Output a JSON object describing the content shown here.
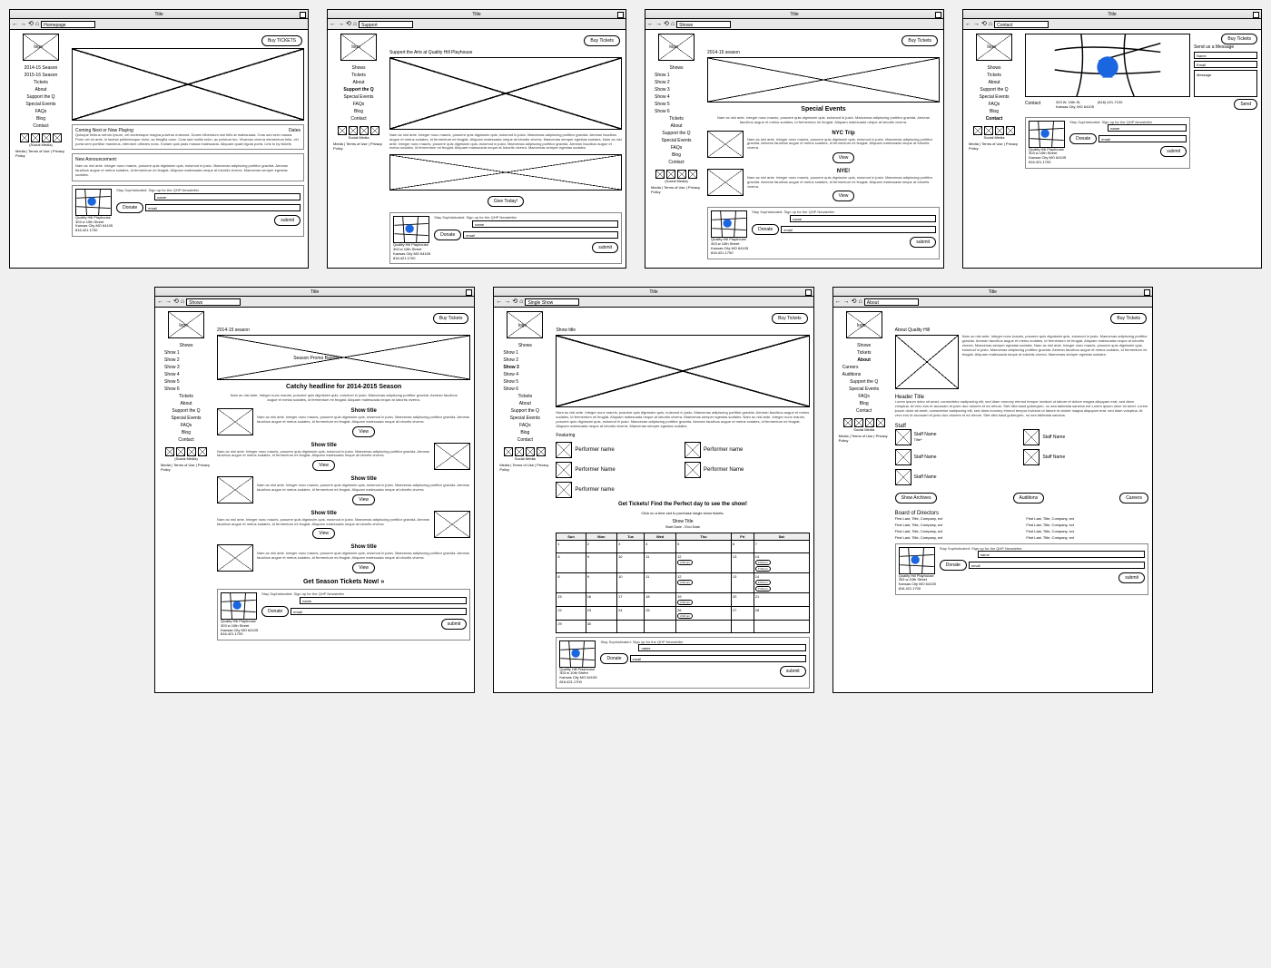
{
  "common": {
    "window_title": "Title",
    "buy_tickets": "Buy Tickets",
    "buy_tickets_caps": "Buy TICKETS",
    "logo": "logo",
    "social_label": "(Social Media)",
    "social_label2": "Social Media",
    "footer_links": "Media | Terms of Use | Privacy Policy",
    "signup_tag": "Stay Sophisticated: Sign up for the QHP Newsletter",
    "donate": "Donate",
    "name_ph": "name",
    "email_ph": "email",
    "submit": "submit",
    "send": "Send",
    "view": "View",
    "address": {
      "name": "Quality Hill Playhouse",
      "street": "303 w 10th Street",
      "city": "Kansas City MO 64105",
      "phone": "816.421.1700"
    },
    "lorem_short": "Nam ac nisl ante. Integer nunc mauris, posuere quis dignissim quis, euismod in justo. Maecenas adipiscing porttitor gravida. Aenean faucibus augue et metus sodales, id fermentum mi feugiat. Aliquam malesuada neque at lobortis viverra.",
    "lorem_med": "Nam ac nisl ante. Integer nunc mauris, posuere quis dignissim quis, euismod in justo. Maecenas adipiscing porttitor gravida. Aenean faucibus augue et metus sodales, id fermentum mi feugiat. Aliquam malesuada neque at lobortis viverra. Maecenas semper egestas sodales. Nam ac nisl ante. Integer nunc mauris, posuere quis dignissim quis, euismod in justo. Maecenas adipiscing porttitor gravida. Aenean faucibus augue et metus sodales, id fermentum mi feugiat. Aliquam malesuada neque at lobortis viverra. Maecenas semper egestas sodales."
  },
  "home": {
    "url": "Homepage",
    "nav": [
      "2014-15 Season",
      "2015-16 Season",
      "Tickets",
      "About",
      "Support the Q",
      "Special Events",
      "FAQs",
      "Blog",
      "Contact"
    ],
    "coming_label": "Coming Next or Now Playing",
    "dates_label": "Dates",
    "promo_text": "Quisque finibus rutrum ipsum, vel scelerisque magna pulvinar euismod. Donec bibendum nisl felis at malesuada. Cras sed sem massa. Proin vel mi ante, in lacinia pellentesque dolor, ac fringilla nunc. Cras sed mollis enim, ac pulvinar leo. Vivamus viverra elementum felis, vel porta sem porttitor maximus, interdum ultricies nunc. Kullam quis justo massa malesuada. Aliquam quam ligula porta. Link to by tickets",
    "new_ann": "New Announcement:",
    "ann_text": "Nam ac nisl ante. Integer nunc mauris, posuere quis dignissim quis, euismod in justo. Maecenas adipiscing porttitor gravida. Aenean faucibus augue et metus sodales, id fermentum mi feugiat. Aliquam malesuada neque at lobortis viverra. Maecenas semper egestas sodales."
  },
  "support": {
    "url": "Support",
    "nav": [
      "Shows",
      "Tickets",
      "About",
      "Support the Q",
      "Special Events",
      "FAQs",
      "Blog",
      "Contact"
    ],
    "headline": "Support the Arts at Quality Hill Playhouse",
    "cta": "Give Today!"
  },
  "shows_events": {
    "url": "Shows",
    "season": "2014-15 season",
    "nav": [
      "Shows",
      "Show 1",
      "Show 2",
      "Show 3",
      "Show 4",
      "Show 5",
      "Show 6",
      "Tickets",
      "About",
      "Support the Q",
      "Special Events",
      "FAQs",
      "Blog",
      "Contact"
    ],
    "special_events": "Special Events",
    "trip": "NYC Trip",
    "nye": "NYE!"
  },
  "contact": {
    "url": "Contact",
    "nav": [
      "Shows",
      "Tickets",
      "About",
      "Support the Q",
      "Special Events",
      "FAQs",
      "Blog",
      "Contact"
    ],
    "send_msg": "Send us a Message",
    "name": "Name",
    "email": "Email",
    "message": "Message",
    "contact_label": "Contact",
    "addr_street": "303 W. 10th St.",
    "addr_city": "Kansas City, MO 64105",
    "phone_fmt": "(816) 421-7100"
  },
  "shows_list": {
    "url": "Shows",
    "season": "2014-15 season",
    "nav": [
      "Shows",
      "Show 1",
      "Show 2",
      "Show 3",
      "Show 4",
      "Show 5",
      "Show 6",
      "Tickets",
      "About",
      "Support the Q",
      "Special Events",
      "FAQs",
      "Blog",
      "Contact"
    ],
    "banner": "Season Promo Banner",
    "headline": "Catchy headline for 2014-2015 Season",
    "show_title": "Show title",
    "cta": "Get Season Tickets Now! »"
  },
  "single_show": {
    "url": "Single Show",
    "nav": [
      "Shows",
      "Show 1",
      "Show 2",
      "Show 3",
      "Show 4",
      "Show 5",
      "Show 6",
      "Tickets",
      "About",
      "Support the Q",
      "Special Events",
      "FAQs",
      "Blog",
      "Contact"
    ],
    "show_title": "Show title",
    "featuring": "Featuring",
    "performer": "Performer Name",
    "performer_lc": "Performer name",
    "tix_head": "Get Tickets! Find the Perfect day to see the show!",
    "tix_sub": "Click on a time slot to purchase single show tickets.",
    "cal_title": "Show Title",
    "cal_dates": "Start Date - End Date",
    "days": [
      "Sun",
      "Mon",
      "Tue",
      "Wed",
      "Thu",
      "Fri",
      "Sat"
    ],
    "weeks": [
      [
        "1",
        "2",
        "3",
        "4",
        "5",
        "6",
        "7"
      ],
      [
        "8",
        "9",
        "10",
        "11",
        "12",
        "13",
        "14"
      ],
      [
        "8",
        "9",
        "10",
        "11",
        "12",
        "13",
        "14"
      ],
      [
        "15",
        "16",
        "17",
        "18",
        "19",
        "20",
        "21"
      ],
      [
        "22",
        "23",
        "24",
        "25",
        "26",
        "27",
        "28"
      ],
      [
        "29",
        "30",
        "",
        "",
        "",
        "",
        ""
      ]
    ],
    "slot": "2:00 pm",
    "slot2": "7:30 pm"
  },
  "about": {
    "url": "About",
    "nav": [
      "Shows",
      "Tickets",
      "About",
      "Careers",
      "Auditions",
      "Support the Q",
      "Special Events",
      "FAQs",
      "Blog",
      "Contact"
    ],
    "title": "About Quality Hill",
    "header_title": "Header Title",
    "header_text": "Lorem ipsum dolor sit amet, consectetur sadipscing elit, sed diam nonumy eirmod tempor invidunt ut labore et dolore magna aliquyam erat, sed diam voluptua. At vero eos et accusam et justo duo dolores et ea rebum. Stet clita kasd gubergren, no sea takimata sanctus est Lorem ipsum dolor sit amet. Lorem ipsum dolor sit amet, consectetur sadipscing elit, sed diam nonumy eirmod tempor invidunt ut labore et dolore magna aliquyam erat, sed diam voluptua. At vero eos et accusam et justo duo dolores et ea rebum. Stet clita kasd gubergren, no sea takimata sanctus.",
    "staff": "Staff",
    "staff_name": "Staff Name",
    "staff_title": "Title*",
    "archives": "Show Archives",
    "auditions": "Auditions",
    "careers": "Careers",
    "board": "Board of Directors",
    "board_entry": "First Last, Title, Company, ect"
  }
}
